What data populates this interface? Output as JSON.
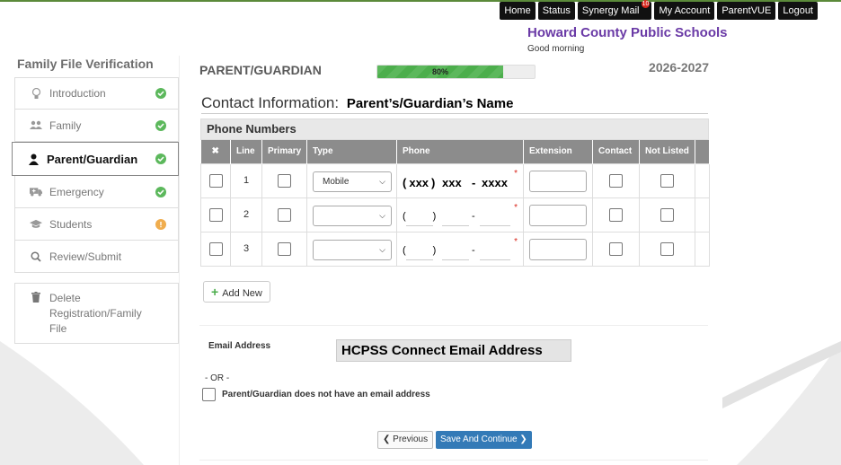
{
  "topnav": {
    "items": [
      "Home",
      "Status",
      "Synergy Mail",
      "My Account",
      "ParentVUE",
      "Logout"
    ],
    "mail_badge": "10"
  },
  "header": {
    "school": "Howard County Public Schools",
    "greeting": "Good morning"
  },
  "sidebar": {
    "title": "Family File Verification",
    "steps": [
      {
        "label": "Introduction",
        "icon": "lightbulb-icon",
        "status": "complete"
      },
      {
        "label": "Family",
        "icon": "users-icon",
        "status": "complete"
      },
      {
        "label": "Parent/Guardian",
        "icon": "user-icon",
        "status": "complete",
        "active": true
      },
      {
        "label": "Emergency",
        "icon": "ambulance-icon",
        "status": "complete"
      },
      {
        "label": "Students",
        "icon": "graduation-cap-icon",
        "status": "warning"
      },
      {
        "label": "Review/Submit",
        "icon": "search-icon",
        "status": "none"
      }
    ],
    "delete_label": "Delete Registration/Family File"
  },
  "main": {
    "section_title": "PARENT/GUARDIAN",
    "progress_text": "80%",
    "progress_value": 0.8,
    "school_year": "2026-2027",
    "contact_label": "Contact Information:",
    "contact_name": "Parent’s/Guardian’s Name"
  },
  "phones": {
    "title": "Phone Numbers",
    "columns": [
      "✖",
      "Line",
      "Primary",
      "Type",
      "Phone",
      "Extension",
      "Contact",
      "Not Listed"
    ],
    "rows": [
      {
        "line": "1",
        "type": "Mobile",
        "area": "xxx",
        "prefix": "xxx",
        "number": "xxxx"
      },
      {
        "line": "2",
        "type": "",
        "area": "",
        "prefix": "",
        "number": ""
      },
      {
        "line": "3",
        "type": "",
        "area": "",
        "prefix": "",
        "number": ""
      }
    ],
    "add_label": "Add New"
  },
  "email": {
    "label": "Email Address",
    "value": "HCPSS Connect Email Address",
    "or_text": "- OR -",
    "no_email_label": "Parent/Guardian does not have an email address"
  },
  "buttons": {
    "previous": "Previous",
    "save": "Save And Continue"
  },
  "colors": {
    "success": "#5cb85c",
    "warning": "#f0ad4e",
    "primary": "#337ab7",
    "brand_purple": "#6a3aa6"
  }
}
